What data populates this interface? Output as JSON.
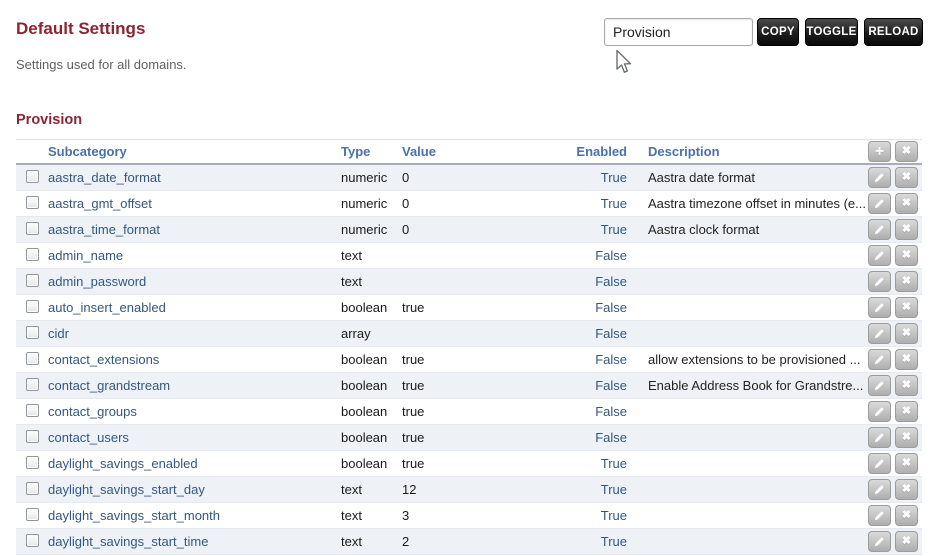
{
  "page": {
    "title": "Default Settings",
    "subtitle": "Settings used for all domains.",
    "section_title": "Provision"
  },
  "toolbar": {
    "search_value": "Provision",
    "copy_label": "COPY",
    "toggle_label": "TOGGLE",
    "reload_label": "RELOAD"
  },
  "icons": {
    "add_glyph": "+",
    "close_glyph": "✖",
    "edit_icon": "pencil-icon"
  },
  "colors": {
    "heading": "#8b2534",
    "table_header_text": "#4a72a7",
    "link": "#35577d",
    "row_stripe": "#eef2f7",
    "dark_button": "#1d1d1d",
    "gray_button": "#bdbdbd"
  },
  "table": {
    "columns": [
      "Subcategory",
      "Type",
      "Value",
      "Enabled",
      "Description"
    ],
    "rows": [
      {
        "subcategory": "aastra_date_format",
        "type": "numeric",
        "value": "0",
        "enabled": "True",
        "description": "Aastra date format"
      },
      {
        "subcategory": "aastra_gmt_offset",
        "type": "numeric",
        "value": "0",
        "enabled": "True",
        "description": "Aastra timezone offset in minutes (e..."
      },
      {
        "subcategory": "aastra_time_format",
        "type": "numeric",
        "value": "0",
        "enabled": "True",
        "description": "Aastra clock format"
      },
      {
        "subcategory": "admin_name",
        "type": "text",
        "value": "",
        "enabled": "False",
        "description": ""
      },
      {
        "subcategory": "admin_password",
        "type": "text",
        "value": "",
        "enabled": "False",
        "description": ""
      },
      {
        "subcategory": "auto_insert_enabled",
        "type": "boolean",
        "value": "true",
        "enabled": "False",
        "description": ""
      },
      {
        "subcategory": "cidr",
        "type": "array",
        "value": "",
        "enabled": "False",
        "description": ""
      },
      {
        "subcategory": "contact_extensions",
        "type": "boolean",
        "value": "true",
        "enabled": "False",
        "description": "allow extensions to be provisioned ..."
      },
      {
        "subcategory": "contact_grandstream",
        "type": "boolean",
        "value": "true",
        "enabled": "False",
        "description": "Enable Address Book for Grandstre..."
      },
      {
        "subcategory": "contact_groups",
        "type": "boolean",
        "value": "true",
        "enabled": "False",
        "description": ""
      },
      {
        "subcategory": "contact_users",
        "type": "boolean",
        "value": "true",
        "enabled": "False",
        "description": ""
      },
      {
        "subcategory": "daylight_savings_enabled",
        "type": "boolean",
        "value": "true",
        "enabled": "True",
        "description": ""
      },
      {
        "subcategory": "daylight_savings_start_day",
        "type": "text",
        "value": "12",
        "enabled": "True",
        "description": ""
      },
      {
        "subcategory": "daylight_savings_start_month",
        "type": "text",
        "value": "3",
        "enabled": "True",
        "description": ""
      },
      {
        "subcategory": "daylight_savings_start_time",
        "type": "text",
        "value": "2",
        "enabled": "True",
        "description": ""
      }
    ]
  }
}
